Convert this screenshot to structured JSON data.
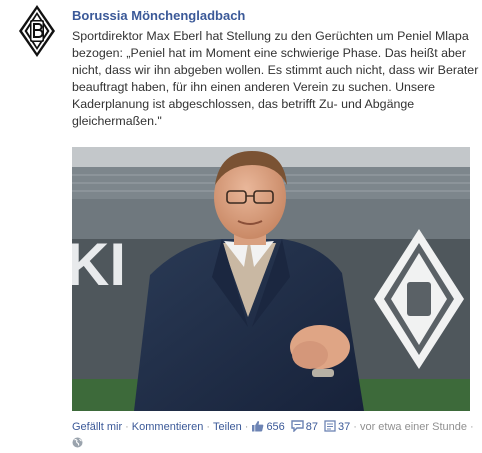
{
  "post": {
    "page_name": "Borussia Mönchengladbach",
    "message": "Sportdirektor Max Eberl hat Stellung zu den Gerüchten um Peniel Mlapa bezogen: „Peniel hat im Moment eine schwierige Phase. Das heißt aber nicht, dass wir ihn abgeben wollen. Es stimmt auch nicht, dass wir Berater beauftragt haben, für ihn einen anderen Verein zu suchen. Unsere Kaderplanung ist abgeschlossen, das betrifft Zu- und Abgänge gleichermaßen.\""
  },
  "footer": {
    "like_label": "Gefällt mir",
    "comment_label": "Kommentieren",
    "share_label": "Teilen",
    "likes_count": "656",
    "comments_count": "87",
    "shares_count": "37",
    "timestamp": "vor etwa einer Stunde",
    "separator": "·"
  },
  "icons": {
    "like": "thumbs-up-icon",
    "comments": "comment-bubble-icon",
    "shares": "share-icon",
    "privacy": "globe-icon"
  },
  "colors": {
    "link": "#3b5998",
    "text": "#333333",
    "muted": "#808080",
    "background": "#ffffff"
  }
}
